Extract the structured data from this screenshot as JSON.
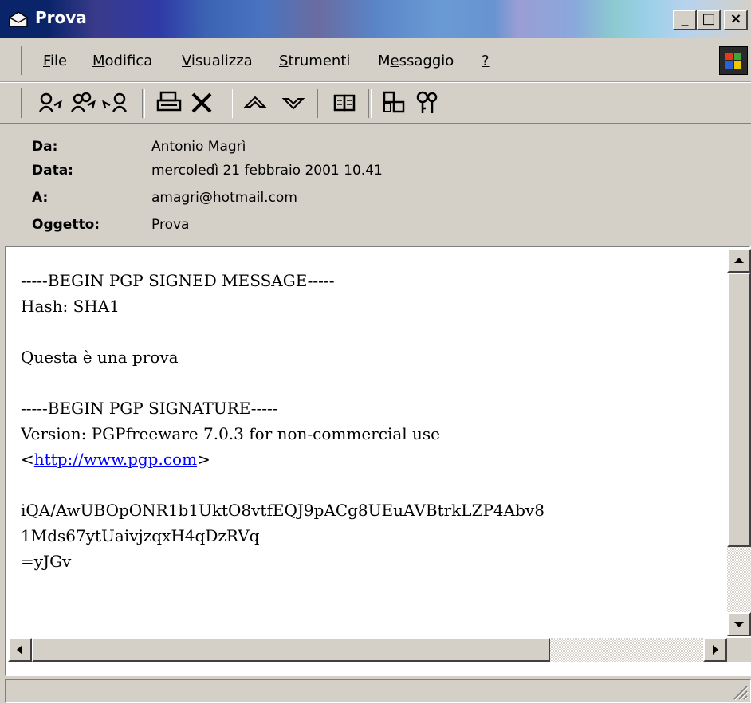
{
  "window": {
    "title": "Prova",
    "controls": {
      "minimize": "_",
      "maximize": "□",
      "close": "×"
    }
  },
  "menu": {
    "items": [
      {
        "mnemonic": "F",
        "rest": "ile"
      },
      {
        "mnemonic": "M",
        "rest": "odifica"
      },
      {
        "mnemonic": "V",
        "rest": "isualizza"
      },
      {
        "mnemonic": "S",
        "rest": "trumenti"
      },
      {
        "pre": "M",
        "mnemonic": "e",
        "rest": "ssaggio"
      },
      {
        "mnemonic": "?",
        "rest": ""
      }
    ]
  },
  "toolbar": {
    "icons": [
      "reply-icon",
      "reply-all-icon",
      "forward-icon",
      "print-icon",
      "delete-icon",
      "previous-icon",
      "next-icon",
      "address-book-icon",
      "encoding-icon",
      "key-icon"
    ]
  },
  "headers": {
    "from_label": "Da:",
    "from_value": "Antonio Magrì",
    "date_label": "Data:",
    "date_value": "mercoledì 21 febbraio 2001 10.41",
    "to_label": "A:",
    "to_value": "amagri@hotmail.com",
    "subject_label": "Oggetto:",
    "subject_value": "Prova"
  },
  "message": {
    "line1": "-----BEGIN PGP SIGNED MESSAGE-----",
    "line2": "Hash: SHA1",
    "line4": "Questa è una prova",
    "line6": "-----BEGIN PGP SIGNATURE-----",
    "line7": "Version: PGPfreeware 7.0.3 for non-commercial use",
    "link_open": "<",
    "link": "http://www.pgp.com",
    "link_close": ">",
    "line10": "iQA/AwUBOpONR1b1UktO8vtfEQJ9pACg8UEuAVBtrkLZP4Abv8",
    "line11": "1Mds67ytUaivjzqxH4qDzRVq",
    "line12": "=yJGv"
  },
  "colors": {
    "face": "#d4d0c8",
    "link": "#0000ff",
    "title_text": "#ffffff"
  }
}
